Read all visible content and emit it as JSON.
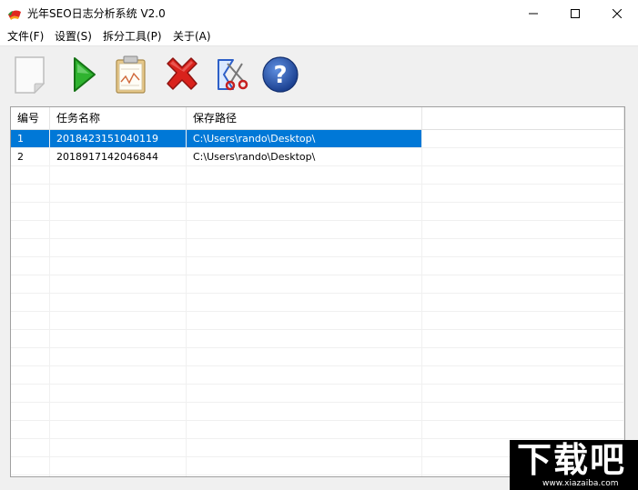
{
  "window": {
    "title": "光年SEO日志分析系统 V2.0"
  },
  "menu": [
    {
      "label": "文件(F)"
    },
    {
      "label": "设置(S)"
    },
    {
      "label": "拆分工具(P)"
    },
    {
      "label": "关于(A)"
    }
  ],
  "toolbar": {
    "icons": [
      "new-file-icon",
      "start-play-icon",
      "clipboard-report-icon",
      "delete-x-icon",
      "split-scissors-icon",
      "help-question-icon"
    ]
  },
  "table": {
    "headers": [
      "编号",
      "任务名称",
      "保存路径"
    ],
    "rows": [
      [
        "1",
        "2018423151040119",
        "C:\\Users\\rando\\Desktop\\"
      ],
      [
        "2",
        "2018917142046844",
        "C:\\Users\\rando\\Desktop\\"
      ]
    ],
    "selected_row": 0
  },
  "watermark": {
    "text": "下载吧",
    "url": "www.xiazaiba.com"
  },
  "colors": {
    "selection": "#0078d7",
    "play_green": "#2fb32f",
    "delete_red": "#d9221c",
    "help_blue": "#1f4fa8"
  }
}
